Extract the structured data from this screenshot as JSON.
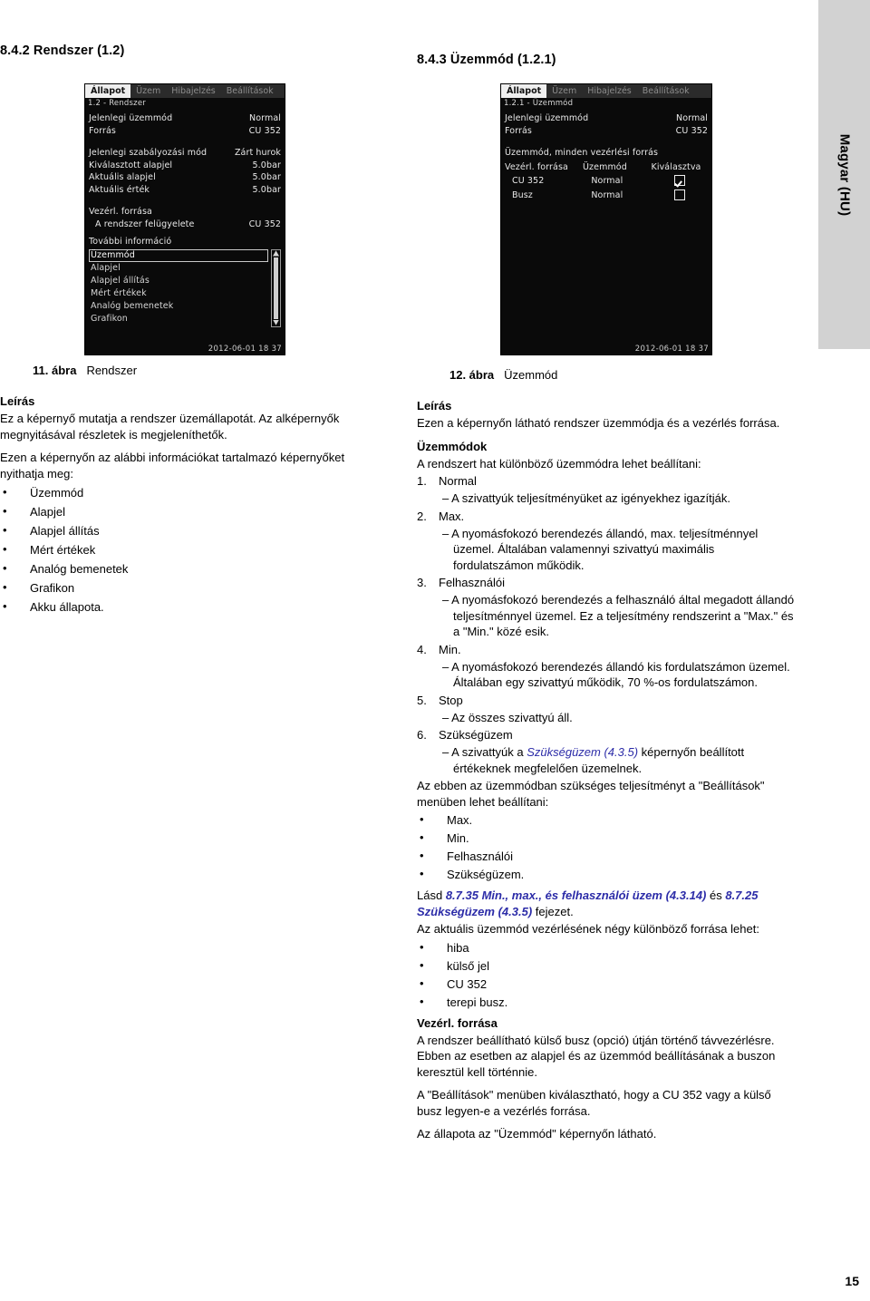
{
  "lang_tab": "Magyar (HU)",
  "page_number": "15",
  "sections": {
    "left_heading": "8.4.2 Rendszer (1.2)",
    "right_heading": "8.4.3 Üzemmód (1.2.1)"
  },
  "screen_1": {
    "menubar": [
      "Állapot",
      "Üzem",
      "Hibajelzés",
      "Beállítások"
    ],
    "active_menu": "Állapot",
    "breadcrumb": "1.2 - Rendszer",
    "rows_group_1": [
      {
        "label": "Jelenlegi üzemmód",
        "value": "Normal"
      },
      {
        "label": "Forrás",
        "value": "CU 352"
      }
    ],
    "rows_group_2": [
      {
        "label": "Jelenlegi szabályozási mód",
        "value": "Zárt hurok"
      },
      {
        "label": "Kiválasztott alapjel",
        "value": "5.0bar"
      },
      {
        "label": "Aktuális alapjel",
        "value": "5.0bar"
      },
      {
        "label": "Aktuális érték",
        "value": "5.0bar"
      }
    ],
    "control_source_title": "Vezérl. forrása",
    "control_source_row": {
      "label": "A rendszer felügyelete",
      "value": "CU 352"
    },
    "more_info_title": "További információ",
    "list": [
      {
        "label": "Üzemmód",
        "selected": true
      },
      {
        "label": "Alapjel",
        "selected": false
      },
      {
        "label": "Alapjel állítás",
        "selected": false
      },
      {
        "label": "Mért értékek",
        "selected": false
      },
      {
        "label": "Analóg bemenetek",
        "selected": false
      },
      {
        "label": "Grafikon",
        "selected": false
      }
    ],
    "timestamp": "2012-06-01  18 37"
  },
  "screen_2": {
    "menubar": [
      "Állapot",
      "Üzem",
      "Hibajelzés",
      "Beállítások"
    ],
    "active_menu": "Állapot",
    "breadcrumb": "1.2.1 - Üzemmód",
    "rows_group_1": [
      {
        "label": "Jelenlegi üzemmód",
        "value": "Normal"
      },
      {
        "label": "Forrás",
        "value": "CU 352"
      }
    ],
    "table_title": "Üzemmód, minden vezérlési forrás",
    "table_headers": [
      "Vezérl. forrása",
      "Üzemmód",
      "Kiválasztva"
    ],
    "table_rows": [
      {
        "source": "CU 352",
        "mode": "Normal",
        "selected": true
      },
      {
        "source": "Busz",
        "mode": "Normal",
        "selected": false
      }
    ],
    "timestamp": "2012-06-01  18 37"
  },
  "left_column": {
    "figure": {
      "number": "11. ábra",
      "title": "Rendszer"
    },
    "desc_heading": "Leírás",
    "para_1": "Ez a képernyő mutatja a rendszer üzemállapotát. Az alképernyők megnyitásával részletek is megjeleníthetők.",
    "para_2": "Ezen a képernyőn az alábbi információkat tartalmazó képernyőket nyithatja meg:",
    "bullets": [
      "Üzemmód",
      "Alapjel",
      "Alapjel állítás",
      "Mért értékek",
      "Analóg bemenetek",
      "Grafikon",
      "Akku állapota."
    ]
  },
  "right_column": {
    "figure": {
      "number": "12. ábra",
      "title": "Üzemmód"
    },
    "desc_heading": "Leírás",
    "para_1": "Ezen a képernyőn látható rendszer üzemmódja és a vezérlés forrása.",
    "modes_heading": "Üzemmódok",
    "modes_intro": "A rendszert hat különböző üzemmódra lehet beállítani:",
    "modes": [
      {
        "n": "1.",
        "name": "Normal",
        "detail": "A szivattyúk teljesítményüket az igényekhez igazítják."
      },
      {
        "n": "2.",
        "name": "Max.",
        "detail": "A nyomásfokozó berendezés állandó, max. teljesítménnyel üzemel. Általában valamennyi szivattyú maximális fordulatszámon működik."
      },
      {
        "n": "3.",
        "name": "Felhasználói",
        "detail": "A nyomásfokozó berendezés a felhasználó által megadott állandó teljesítménnyel üzemel. Ez a teljesítmény rendszerint a \"Max.\" és a \"Min.\" közé esik."
      },
      {
        "n": "4.",
        "name": "Min.",
        "detail": "A nyomásfokozó berendezés állandó kis fordulatszámon üzemel. Általában egy szivattyú működik, 70 %-os fordulatszámon."
      },
      {
        "n": "5.",
        "name": "Stop",
        "detail": "Az összes szivattyú áll."
      },
      {
        "n": "6.",
        "name": "Szükségüzem",
        "detail_pre": "A szivattyúk a ",
        "detail_link": "Szükségüzem (4.3.5)",
        "detail_post": " képernyőn beállított értékeknek megfelelően üzemelnek."
      }
    ],
    "perf_para": "Az ebben az üzemmódban szükséges teljesítményt a \"Beállítások\" menüben lehet beállítani:",
    "perf_bullets": [
      "Max.",
      "Min.",
      "Felhasználói",
      "Szükségüzem."
    ],
    "see_pre": "Lásd ",
    "see_link_1": "8.7.35 Min., max., és felhasználói üzem (4.3.14)",
    "see_mid": " és ",
    "see_link_2": "8.7.25 Szükségüzem (4.3.5)",
    "see_post": " fejezet.",
    "sources_intro": "Az aktuális üzemmód vezérlésének négy különböző forrása lehet:",
    "sources": [
      "hiba",
      "külső jel",
      "CU 352",
      "terepi busz."
    ],
    "ctrl_heading": "Vezérl. forrása",
    "ctrl_para_1": "A rendszer beállítható külső busz (opció) útján történő távvezérlésre. Ebben az esetben az alapjel és az üzemmód beállításának a buszon keresztül kell történnie.",
    "ctrl_para_2": "A \"Beállítások\" menüben kiválasztható, hogy a CU 352 vagy a külső busz legyen-e a vezérlés forrása.",
    "ctrl_para_3": "Az állapota az \"Üzemmód\" képernyőn látható."
  }
}
